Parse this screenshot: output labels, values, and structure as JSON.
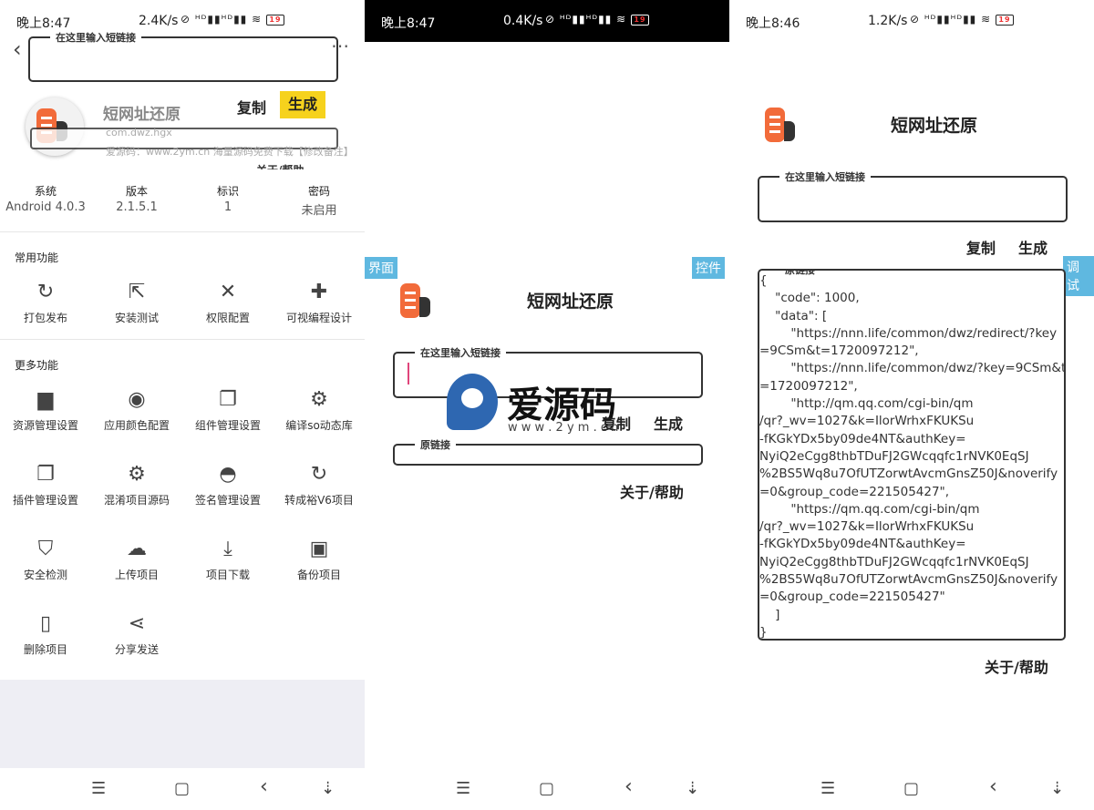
{
  "panel1": {
    "status": {
      "time": "晚上8:47",
      "speed": "2.4K/s",
      "icons": "⊘ ᴴᴰ▮▮ᴴᴰ▮▮ ≋",
      "battery": "19"
    },
    "input": {
      "label": "在这里输入短链接",
      "value": ""
    },
    "copy_label": "复制",
    "generate_label": "生成",
    "app_name": "短网址还原",
    "package": "com.dwz.hgx",
    "source": "爱源码：www.2ym.cn 海量源码免费下载【修改备注】",
    "overlap_text": "关于/帮助",
    "info": [
      {
        "label": "系统",
        "value": "Android 4.0.3"
      },
      {
        "label": "版本",
        "value": "2.1.5.1"
      },
      {
        "label": "标识",
        "value": "1"
      },
      {
        "label": "密码",
        "value": "未启用"
      }
    ],
    "common_title": "常用功能",
    "common": [
      {
        "label": "打包发布",
        "icon": "↻"
      },
      {
        "label": "安装测试",
        "icon": "⇱"
      },
      {
        "label": "权限配置",
        "icon": "✕"
      },
      {
        "label": "可视编程设计",
        "icon": "✚"
      }
    ],
    "more_title": "更多功能",
    "more": [
      {
        "label": "资源管理设置",
        "icon": "▆"
      },
      {
        "label": "应用颜色配置",
        "icon": "◉"
      },
      {
        "label": "组件管理设置",
        "icon": "❐"
      },
      {
        "label": "编译so动态库",
        "icon": "⚙"
      },
      {
        "label": "插件管理设置",
        "icon": "❐"
      },
      {
        "label": "混淆项目源码",
        "icon": "⚙"
      },
      {
        "label": "签名管理设置",
        "icon": "◓"
      },
      {
        "label": "转成裕V6项目",
        "icon": "↻"
      },
      {
        "label": "安全检测",
        "icon": "⛉"
      },
      {
        "label": "上传项目",
        "icon": "☁"
      },
      {
        "label": "项目下载",
        "icon": "⤓"
      },
      {
        "label": "备份项目",
        "icon": "▣"
      },
      {
        "label": "删除项目",
        "icon": "▯"
      },
      {
        "label": "分享发送",
        "icon": "⋖"
      }
    ]
  },
  "panel2": {
    "status": {
      "time": "晚上8:47",
      "speed": "0.4K/s",
      "icons": "⊘ ᴴᴰ▮▮ᴴᴰ▮▮ ≋",
      "battery": "19"
    },
    "tag_left": "界面",
    "tag_right": "控件",
    "title": "短网址还原",
    "input": {
      "label": "在这里输入短链接"
    },
    "copy_label": "复制",
    "generate_label": "生成",
    "original": {
      "label": "原链接"
    },
    "about": "关于/帮助",
    "watermark": {
      "brand": "爱源码",
      "url": "w w w . 2 y m . c n"
    }
  },
  "panel3": {
    "status": {
      "time": "晚上8:46",
      "speed": "1.2K/s",
      "icons": "⊘ ᴴᴰ▮▮ᴴᴰ▮▮ ≋",
      "battery": "19"
    },
    "title": "短网址还原",
    "input": {
      "label": "在这里输入短链接"
    },
    "copy_label": "复制",
    "generate_label": "生成",
    "tag_right": "调试",
    "original": {
      "label": "原链接"
    },
    "result_lines": [
      "{",
      "    \"code\": 1000,",
      "    \"data\": [",
      "        \"https://nnn.life/common/dwz/redirect/?key",
      "=9CSm&t=1720097212\",",
      "        \"https://nnn.life/common/dwz/?key=9CSm&t",
      "=1720097212\",",
      "        \"http://qm.qq.com/cgi-bin/qm",
      "/qr?_wv=1027&k=IlorWrhxFKUKSu",
      "-fKGkYDx5by09de4NT&authKey=",
      "NyiQ2eCgg8thbTDuFJ2GWcqqfc1rNVK0EqSJ",
      "%2BS5Wq8u7OfUTZorwtAvcmGnsZ50J&noverify",
      "=0&group_code=221505427\",",
      "        \"https://qm.qq.com/cgi-bin/qm",
      "/qr?_wv=1027&k=IlorWrhxFKUKSu",
      "-fKGkYDx5by09de4NT&authKey=",
      "NyiQ2eCgg8thbTDuFJ2GWcqqfc1rNVK0EqSJ",
      "%2BS5Wq8u7OfUTZorwtAvcmGnsZ50J&noverify",
      "=0&group_code=221505427\"",
      "    ]",
      "}"
    ],
    "about": "关于/帮助"
  },
  "navbar": {
    "menu": "☰",
    "home": "▢",
    "back": "‹",
    "extra": "⇣"
  }
}
